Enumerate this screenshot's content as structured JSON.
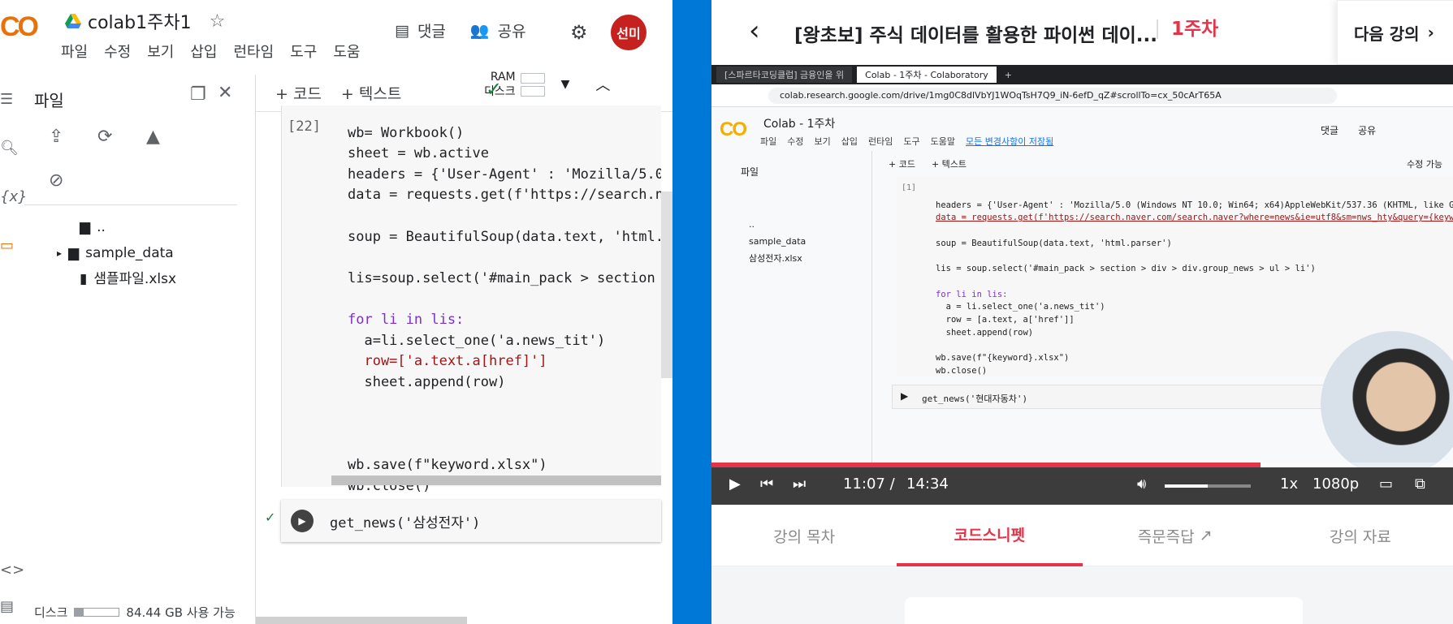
{
  "colab": {
    "logo": "CO",
    "notebook_title": "colab1주차1",
    "menu": [
      "파일",
      "수정",
      "보기",
      "삽입",
      "런타임",
      "도구",
      "도움"
    ],
    "comment_label": "댓글",
    "share_label": "공유",
    "avatar_initials": "선미",
    "files_title": "파일",
    "tree": [
      {
        "name": "..",
        "type": "parent"
      },
      {
        "name": "sample_data",
        "type": "folder"
      },
      {
        "name": "샘플파일.xlsx",
        "type": "file"
      }
    ],
    "disk_label": "디스크",
    "disk_text": "84.44 GB 사용 가능",
    "add_code": "+ 코드",
    "add_text": "+ 텍스트",
    "ram_label": "RAM",
    "disk_short": "디스크",
    "cell_number": "[22]",
    "code_lines": [
      "wb= Workbook()",
      "sheet = wb.active",
      "headers = {'User-Agent' : 'Mozilla/5.0",
      "data = requests.get(f'https://search.na",
      "",
      "soup = BeautifulSoup(data.text, 'html.p",
      "",
      "lis=soup.select('#main_pack > section >",
      "",
      "for li in lis:",
      "  a=li.select_one('a.news_tit')",
      "  row=['a.text.a[href]']",
      "  sheet.append(row)",
      "",
      "",
      "",
      "wb.save(f\"keyword.xlsx\")",
      "wb.close()"
    ],
    "call_line": "get_news('삼성전자')"
  },
  "player": {
    "lecture_title": "[왕초보] 주식 데이터를 활용한 파이썬 데이...",
    "week": "1주차",
    "next_label": "다음 강의",
    "browser_tabs": [
      "[스파르타코딩클럽] 금융인을 위",
      "Colab - 1주차 - Colaboratory"
    ],
    "url": "colab.research.google.com/drive/1mg0C8dlVbYJ1WOqTsH7Q9_iN-6efD_qZ#scrollTo=cx_50cArT65A",
    "inner_title": "Colab - 1주차",
    "inner_menu": [
      "파일",
      "수정",
      "보기",
      "삽입",
      "런타임",
      "도구",
      "도움말"
    ],
    "inner_saved": "모든 변경사항이 저장됨",
    "inner_comment": "댓글",
    "inner_share": "공유",
    "inner_files": "파일",
    "inner_add_code": "+ 코드",
    "inner_add_text": "+ 텍스트",
    "inner_edit": "수정 가능",
    "inner_tree": [
      "..",
      "sample_data",
      "삼성전자.xlsx"
    ],
    "inner_cell_number": "[1]",
    "inner_code": [
      "headers = {'User-Agent' : 'Mozilla/5.0 (Windows NT 10.0; Win64; x64)AppleWebKit/537.36 (KHTML, like Gecko)",
      "data = requests.get(f'https://search.naver.com/search.naver?where=news&ie=utf8&sm=nws_hty&query={keyword}'",
      "",
      "soup = BeautifulSoup(data.text, 'html.parser')",
      "",
      "lis = soup.select('#main_pack > section > div > div.group_news > ul > li')",
      "",
      "for li in lis:",
      "  a = li.select_one('a.news_tit')",
      "  row = [a.text, a['href']]",
      "  sheet.append(row)",
      "",
      "wb.save(f\"{keyword}.xlsx\")",
      "wb.close()"
    ],
    "inner_call": "get_news('현대자동차')",
    "current_time": "11:07 /",
    "duration": "14:34",
    "progress": 0.74,
    "volume": 0.5,
    "speed": "1x",
    "quality": "1080p",
    "tabs": [
      "강의 목차",
      "코드스니펫",
      "즉문즉답",
      "강의 자료"
    ],
    "active_tab": 1
  }
}
